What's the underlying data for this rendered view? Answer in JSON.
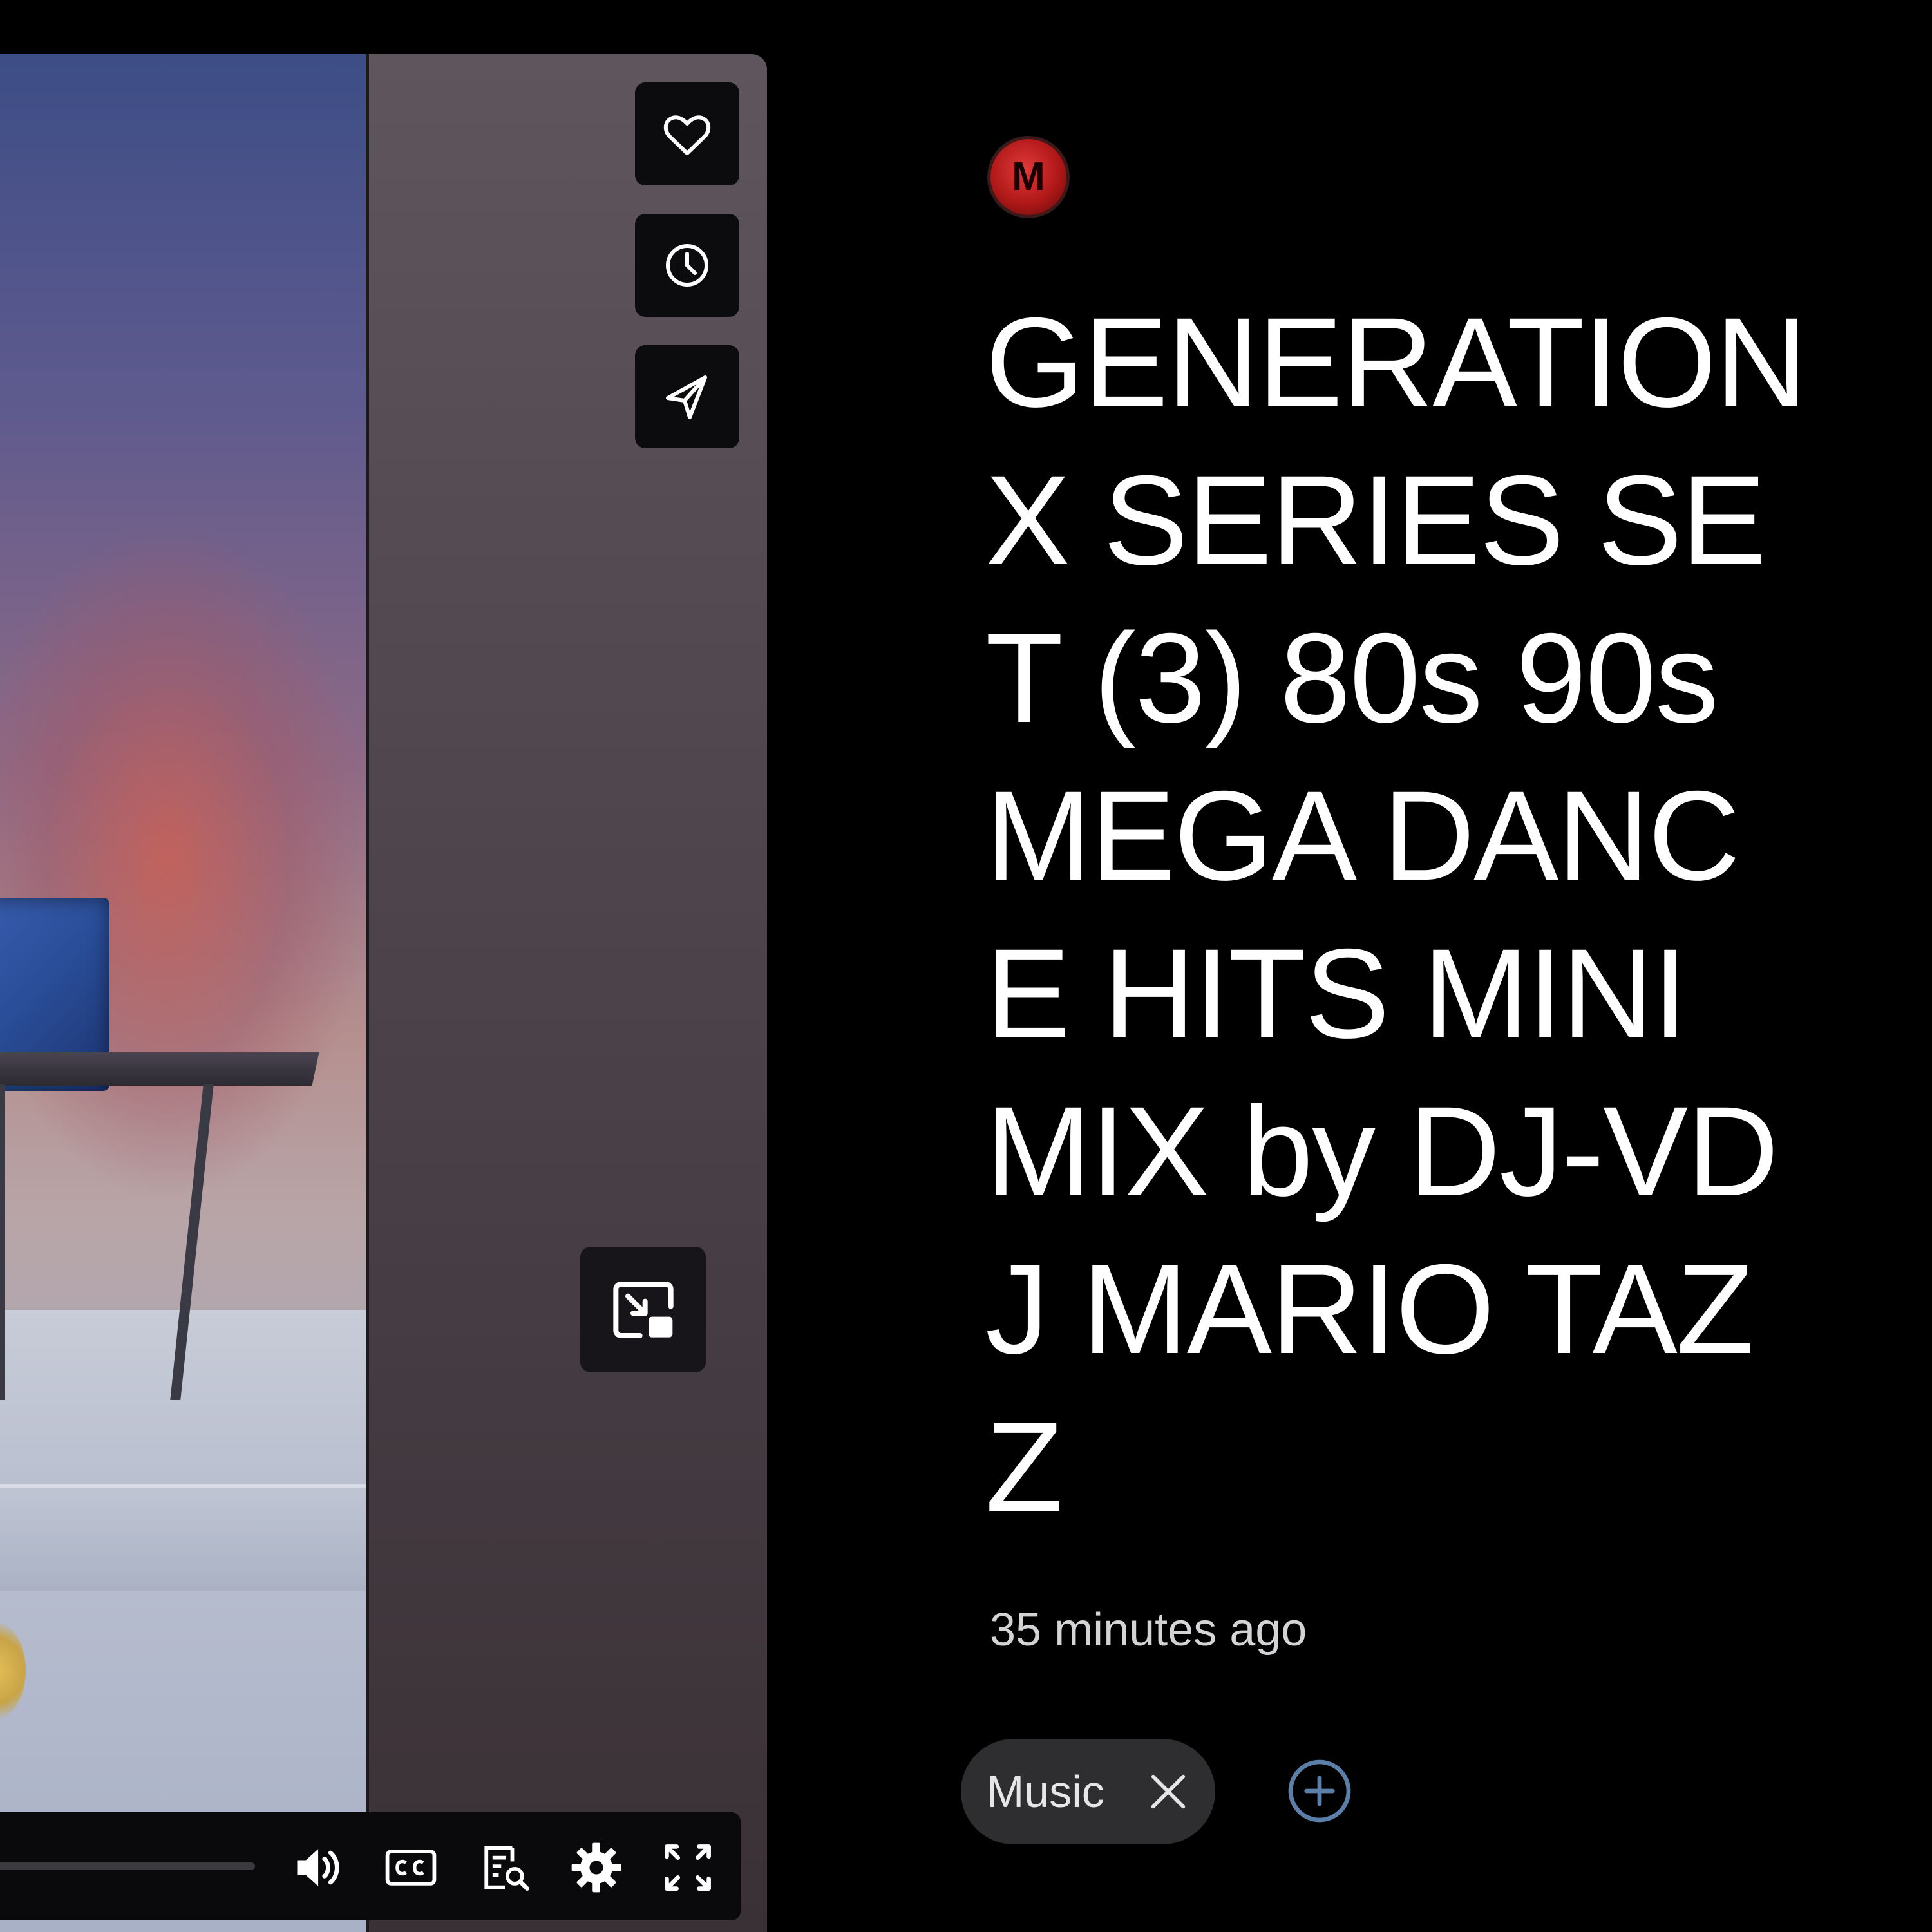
{
  "video": {
    "title": "GENERATION X SERIES SET (3) 80s 90s MEGA DANCE HITS MINI MIX by DJ-VDJ MARIO TAZZ",
    "posted": "35 minutes ago",
    "channel_avatar_letter": "M"
  },
  "overlay_buttons": {
    "like_icon": "heart-icon",
    "watch_later_icon": "clock-icon",
    "share_icon": "send-icon",
    "miniplayer_icon": "miniplayer-icon"
  },
  "player_controls": {
    "icons": [
      "volume-icon",
      "closed-captions-icon",
      "transcript-icon",
      "settings-icon",
      "fullscreen-icon"
    ]
  },
  "tags": {
    "items": [
      {
        "label": "Music",
        "remove_icon": "close-icon"
      }
    ],
    "add_icon": "plus-circle-icon"
  },
  "colors": {
    "background": "#000000",
    "title_text": "#ffffff",
    "timestamp_text": "#d4d4d6",
    "chip_background": "#2e2d30",
    "add_tag_accent": "#5b7fa8",
    "avatar_red": "#c21d1d"
  }
}
